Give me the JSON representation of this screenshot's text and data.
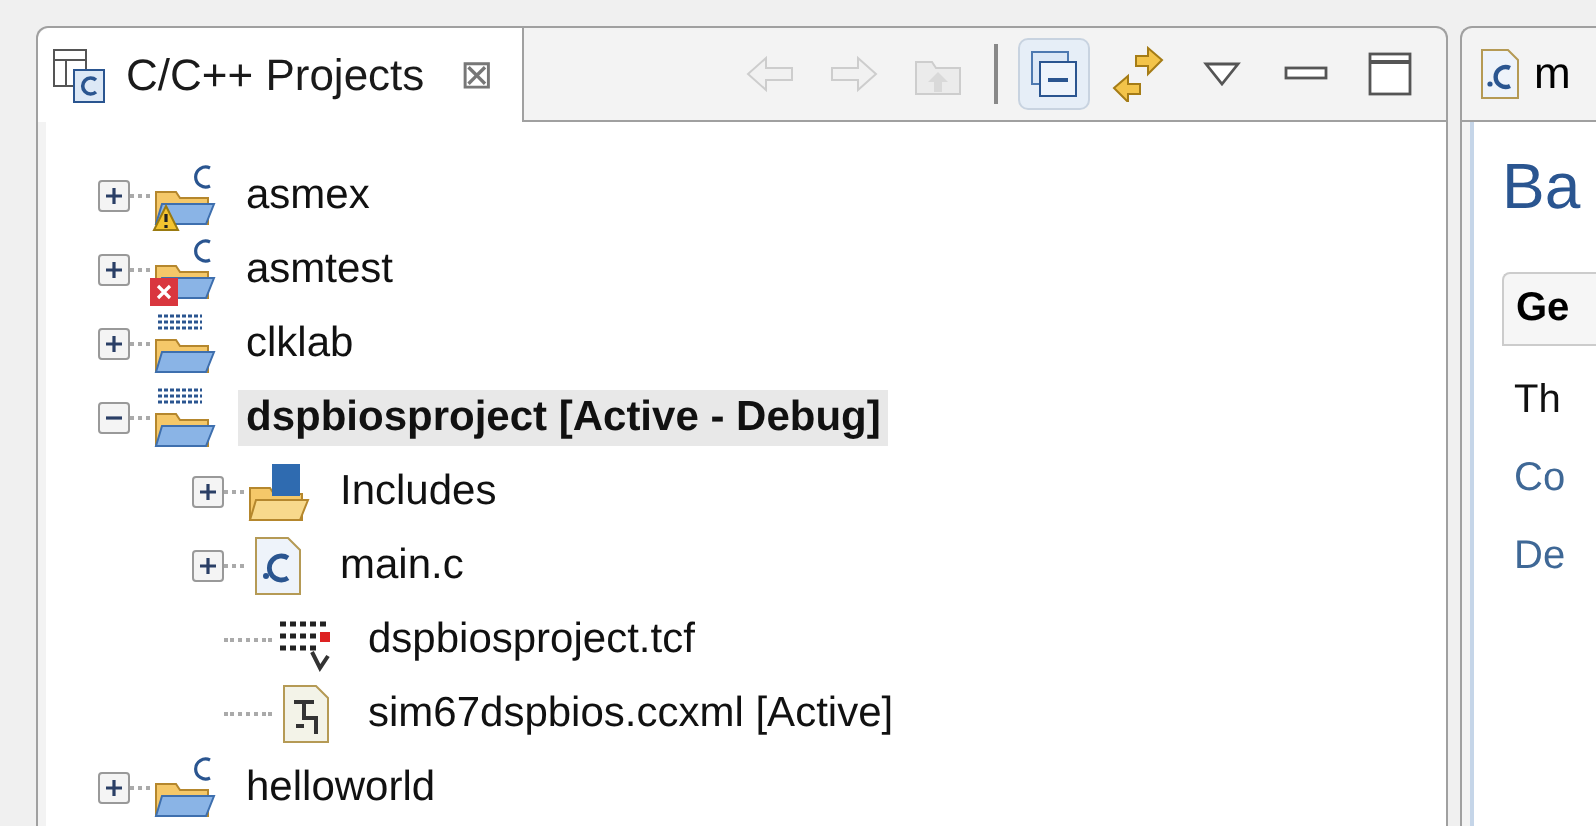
{
  "projects_view": {
    "title": "C/C++ Projects",
    "close_glyph": "⊠",
    "toolbar": [
      {
        "kind": "back",
        "disabled": true,
        "pressed": false
      },
      {
        "kind": "forward",
        "disabled": true,
        "pressed": false
      },
      {
        "kind": "up",
        "disabled": true,
        "pressed": false
      },
      {
        "kind": "collapse",
        "disabled": false,
        "pressed": true
      },
      {
        "kind": "link",
        "disabled": false,
        "pressed": false
      },
      {
        "kind": "menu",
        "disabled": false,
        "pressed": false
      },
      {
        "kind": "minimize",
        "disabled": false,
        "pressed": false
      },
      {
        "kind": "maximize",
        "disabled": false,
        "pressed": false
      }
    ],
    "tree": [
      {
        "label": "asmex",
        "kind": "c-project",
        "warning": true,
        "error": false,
        "has_children": true,
        "expanded": false,
        "selected": false,
        "active": false
      },
      {
        "label": "asmtest",
        "kind": "c-project",
        "warning": false,
        "error": true,
        "has_children": true,
        "expanded": false,
        "selected": false,
        "active": false
      },
      {
        "label": "clklab",
        "kind": "rtsc-project",
        "warning": false,
        "error": false,
        "has_children": true,
        "expanded": false,
        "selected": false,
        "active": false
      },
      {
        "label": "dspbiosproject  [Active - Debug]",
        "kind": "rtsc-project",
        "warning": false,
        "error": false,
        "has_children": true,
        "expanded": true,
        "selected": true,
        "active": true,
        "children": [
          {
            "label": "Includes",
            "kind": "includes",
            "warning": false,
            "error": false,
            "has_children": true,
            "expanded": false,
            "selected": false,
            "active": false
          },
          {
            "label": "main.c",
            "kind": "c-file",
            "warning": false,
            "error": false,
            "has_children": true,
            "expanded": false,
            "selected": false,
            "active": false
          },
          {
            "label": "dspbiosproject.tcf",
            "kind": "tcf-file",
            "warning": false,
            "error": false,
            "has_children": false,
            "selected": false,
            "active": false
          },
          {
            "label": "sim67dspbios.ccxml [Active]",
            "kind": "ccxml-file",
            "warning": false,
            "error": false,
            "has_children": false,
            "selected": false,
            "active": false
          }
        ]
      },
      {
        "label": "helloworld",
        "kind": "c-project",
        "warning": false,
        "error": false,
        "has_children": true,
        "expanded": false,
        "selected": false,
        "active": false
      }
    ]
  },
  "editor": {
    "tab_label": "m",
    "heading": "Ba",
    "section_tab": "Ge",
    "lines": [
      {
        "text": "Th",
        "kind": "text"
      },
      {
        "text": "Co",
        "kind": "link"
      },
      {
        "text": "De",
        "kind": "link"
      }
    ]
  }
}
